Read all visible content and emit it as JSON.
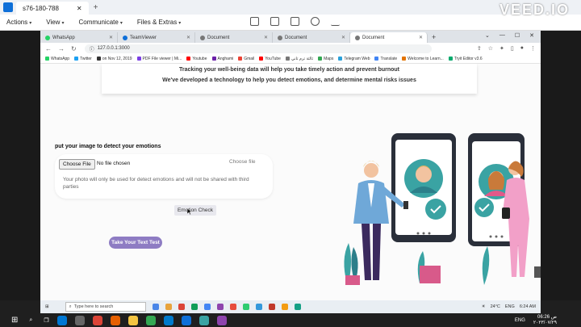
{
  "teamviewer": {
    "tab_title": "s76-180-788",
    "menu": [
      "Actions",
      "View",
      "Communicate",
      "Files & Extras"
    ]
  },
  "watermark": "VEED.IO",
  "browser": {
    "tabs": [
      {
        "label": "WhatsApp",
        "color": "#25d366"
      },
      {
        "label": "TeamViewer",
        "color": "#0e6fd8"
      },
      {
        "label": "Document",
        "color": "#444444"
      },
      {
        "label": "Document",
        "color": "#444444"
      },
      {
        "label": "Document",
        "color": "#444444",
        "active": true
      }
    ],
    "url": "127.0.0.1:3000",
    "bookmarks": [
      {
        "label": "WhatsApp",
        "color": "#25d366"
      },
      {
        "label": "Twitter",
        "color": "#1da1f2"
      },
      {
        "label": "on Nov 12, 2019",
        "color": "#333333"
      },
      {
        "label": "PDF File viewer | Mi...",
        "color": "#7b3fe4"
      },
      {
        "label": "Youtube",
        "color": "#ff0000"
      },
      {
        "label": "Anghami",
        "color": "#6b21a8"
      },
      {
        "label": "Gmail",
        "color": "#ea4335"
      },
      {
        "label": "YouTube",
        "color": "#ff0000"
      },
      {
        "label": "ثالثة ترم تاني",
        "color": "#777777"
      },
      {
        "label": "Maps",
        "color": "#34a853"
      },
      {
        "label": "Telegram Web",
        "color": "#2aa1da"
      },
      {
        "label": "Translate",
        "color": "#4285f4"
      },
      {
        "label": "Welcome to Learn...",
        "color": "#e37400"
      },
      {
        "label": "Tryit Editor v3.6",
        "color": "#04aa6d"
      }
    ]
  },
  "page": {
    "headline_1": "Tracking your well-being data will help you take timely action and prevent burnout",
    "headline_2": "We've developed a technology to help you detect emotions, and determine mental risks issues",
    "upload_title": "put your image to detect your emotions",
    "choose_file": "Choose File",
    "no_file": "No file chosen",
    "choose_file_right": "Choose file",
    "privacy_note": "Your photo will only be used for detect emotions and will not be shared with third parties",
    "emotion_button": "Emotion Check",
    "text_test_button": "Take Your Text Test",
    "accent": "#8e7cc3"
  },
  "taskbar": {
    "search_placeholder": "Type here to search",
    "weather": "24°C",
    "lang": "ENG",
    "time": "06:26 ص",
    "date": "٢٠٢٣/٠٧/٢٩",
    "time_small": "6:24 AM"
  }
}
